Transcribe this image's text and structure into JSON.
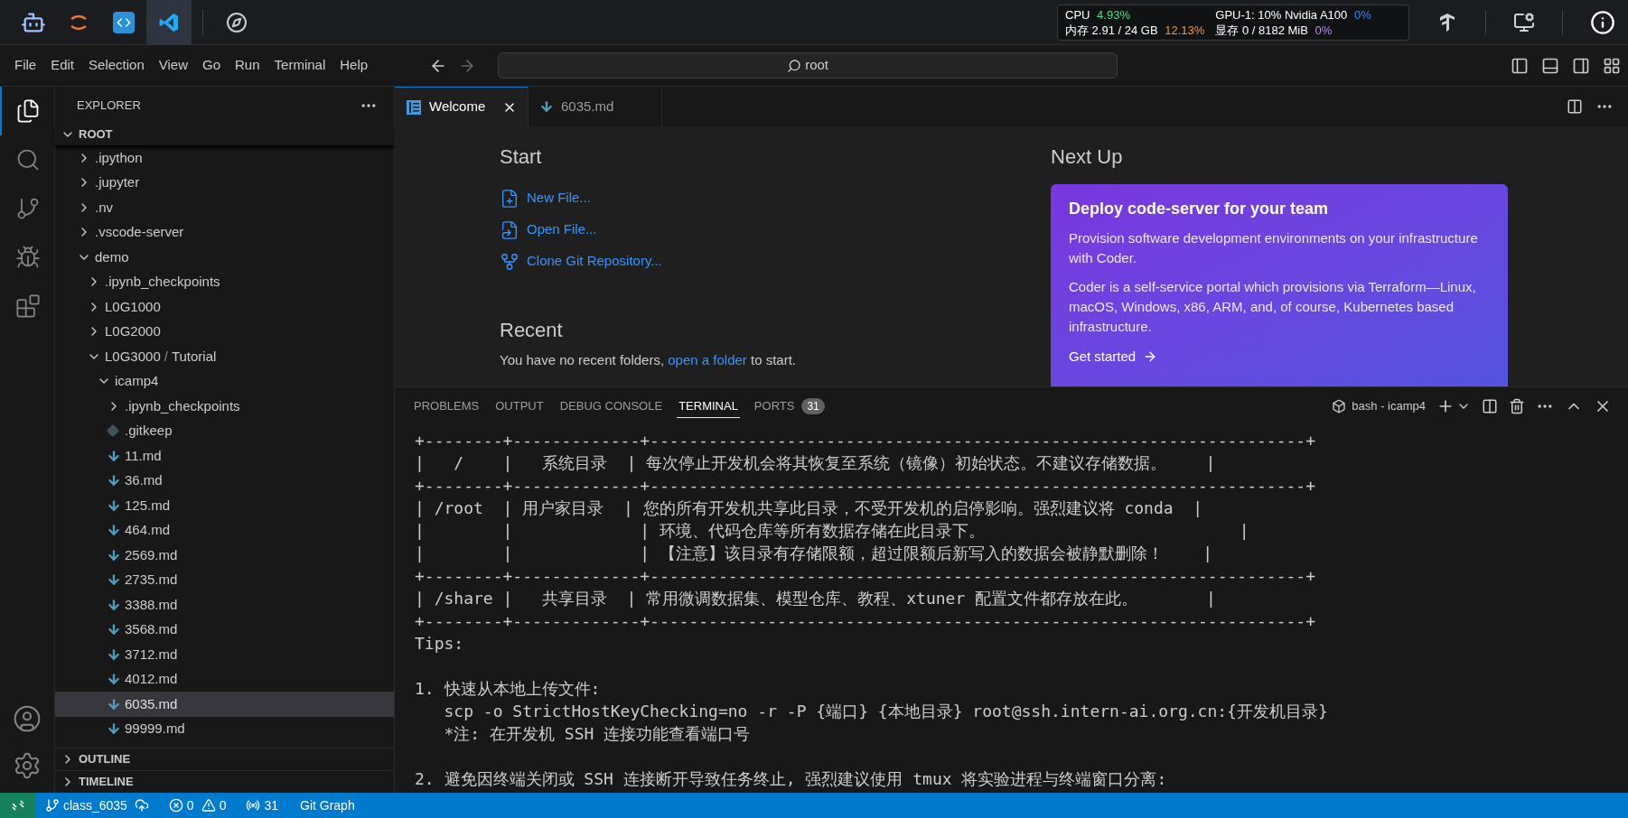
{
  "topbar": {
    "apps": [
      {
        "selected": false
      },
      {
        "selected": false
      },
      {
        "selected": false
      },
      {
        "selected": true
      },
      {
        "selected": false
      }
    ],
    "monitor": {
      "cpu_label": "CPU",
      "cpu_value": "4.93%",
      "gpu_label": "GPU-1: 10% Nvidia A100",
      "gpu_value": "0%",
      "mem_label": "内存 2.91 / 24 GB",
      "mem_value": "12.13%",
      "vram_label": "显存 0 / 8182 MiB",
      "vram_value": "0%"
    }
  },
  "menu": [
    "File",
    "Edit",
    "Selection",
    "View",
    "Go",
    "Run",
    "Terminal",
    "Help"
  ],
  "command_center": {
    "value": "root"
  },
  "activity_bar": [
    {
      "selected": true
    },
    {
      "selected": false
    },
    {
      "selected": false
    },
    {
      "selected": false
    },
    {
      "selected": false
    }
  ],
  "explorer": {
    "title": "EXPLORER",
    "root": "ROOT",
    "tree": [
      {
        "label": ".ipython",
        "kind": "folder",
        "expanded": false,
        "selected": false
      },
      {
        "label": ".jupyter",
        "kind": "folder",
        "expanded": false,
        "selected": false
      },
      {
        "label": ".nv",
        "kind": "folder",
        "expanded": false,
        "selected": false
      },
      {
        "label": ".vscode-server",
        "kind": "folder",
        "expanded": false,
        "selected": false
      },
      {
        "label": "demo",
        "kind": "folder",
        "expanded": true,
        "selected": false,
        "children": [
          {
            "label": ".ipynb_checkpoints",
            "kind": "folder",
            "expanded": false,
            "selected": false
          },
          {
            "label": "L0G1000",
            "kind": "folder",
            "expanded": false,
            "selected": false
          },
          {
            "label": "L0G2000",
            "kind": "folder",
            "expanded": false,
            "selected": false
          },
          {
            "label": "L0G3000",
            "separator": "/",
            "sublabel": "Tutorial",
            "kind": "folder",
            "expanded": true,
            "selected": false,
            "children": [
              {
                "label": "icamp4",
                "kind": "folder",
                "expanded": true,
                "selected": false,
                "children": [
                  {
                    "label": ".ipynb_checkpoints",
                    "kind": "folder",
                    "expanded": false,
                    "selected": false
                  },
                  {
                    "label": ".gitkeep",
                    "kind": "config",
                    "selected": false
                  },
                  {
                    "label": "11.md",
                    "kind": "markdown",
                    "selected": false
                  },
                  {
                    "label": "36.md",
                    "kind": "markdown",
                    "selected": false
                  },
                  {
                    "label": "125.md",
                    "kind": "markdown",
                    "selected": false
                  },
                  {
                    "label": "464.md",
                    "kind": "markdown",
                    "selected": false
                  },
                  {
                    "label": "2569.md",
                    "kind": "markdown",
                    "selected": false
                  },
                  {
                    "label": "2735.md",
                    "kind": "markdown",
                    "selected": false
                  },
                  {
                    "label": "3388.md",
                    "kind": "markdown",
                    "selected": false
                  },
                  {
                    "label": "3568.md",
                    "kind": "markdown",
                    "selected": false
                  },
                  {
                    "label": "3712.md",
                    "kind": "markdown",
                    "selected": false
                  },
                  {
                    "label": "4012.md",
                    "kind": "markdown",
                    "selected": false
                  },
                  {
                    "label": "6035.md",
                    "kind": "markdown",
                    "selected": true
                  },
                  {
                    "label": "99999.md",
                    "kind": "markdown",
                    "selected": false
                  }
                ]
              }
            ]
          }
        ]
      }
    ],
    "sections": [
      {
        "label": "OUTLINE",
        "expanded": false
      },
      {
        "label": "TIMELINE",
        "expanded": false
      }
    ]
  },
  "editor_tabs": [
    {
      "label": "Welcome",
      "kind": "welcome",
      "selected": true
    },
    {
      "label": "6035.md",
      "kind": "markdown",
      "selected": false
    }
  ],
  "welcome": {
    "start_title": "Start",
    "start_links": [
      "New File...",
      "Open File...",
      "Clone Git Repository..."
    ],
    "recent_title": "Recent",
    "recent_text_before": "You have no recent folders,",
    "recent_link": "open a folder",
    "recent_text_after": "to start.",
    "next_title": "Next Up",
    "card": {
      "title": "Deploy code-server for your team",
      "paragraphs": [
        "Provision software development environments on your infrastructure with Coder.",
        "Coder is a self-service portal which provisions via Terraform—Linux, macOS, Windows, x86, ARM, and, of course, Kubernetes based infrastructure."
      ],
      "action": "Get started"
    }
  },
  "panel": {
    "tabs": [
      {
        "label": "PROBLEMS",
        "selected": false
      },
      {
        "label": "OUTPUT",
        "selected": false
      },
      {
        "label": "DEBUG CONSOLE",
        "selected": false
      },
      {
        "label": "TERMINAL",
        "selected": true
      },
      {
        "label": "PORTS",
        "selected": false,
        "badge": "31"
      }
    ],
    "terminal_name": "bash - icamp4",
    "lines": [
      "+--------+-------------+-------------------------------------------------------------------+",
      "|   /    |   系统目录  | 每次停止开发机会将其恢复至系统（镜像）初始状态。不建议存储数据。    |",
      "+--------+-------------+-------------------------------------------------------------------+",
      "| /root  | 用户家目录  | 您的所有开发机共享此目录，不受开发机的启停影响。强烈建议将 conda  |",
      "|        |             | 环境、代码仓库等所有数据存储在此目录下。                          |",
      "|        |             | 【注意】该目录有存储限额，超过限额后新写入的数据会被静默删除！    |",
      "+--------+-------------+-------------------------------------------------------------------+",
      "| /share |   共享目录  | 常用微调数据集、模型仓库、教程、xtuner 配置文件都存放在此。       |",
      "+--------+-------------+-------------------------------------------------------------------+",
      "Tips:",
      {
        "text": "1. 快速从本地上传文件:",
        "spaced": true
      },
      "   scp -o StrictHostKeyChecking=no -r -P {端口} {本地目录} root@ssh.intern-ai.org.cn:{开发机目录}",
      "   *注: 在开发机 SSH 连接功能查看端口号",
      {
        "text": "2. 避免因终端关闭或 SSH 连接断开导致任务终止, 强烈建议使用 tmux 将实验进程与终端窗口分离:",
        "spaced": true
      }
    ]
  },
  "status_bar": {
    "branch": "class_6035",
    "errors": "0",
    "warnings": "0",
    "ports": "31",
    "git_graph": "Git Graph"
  }
}
